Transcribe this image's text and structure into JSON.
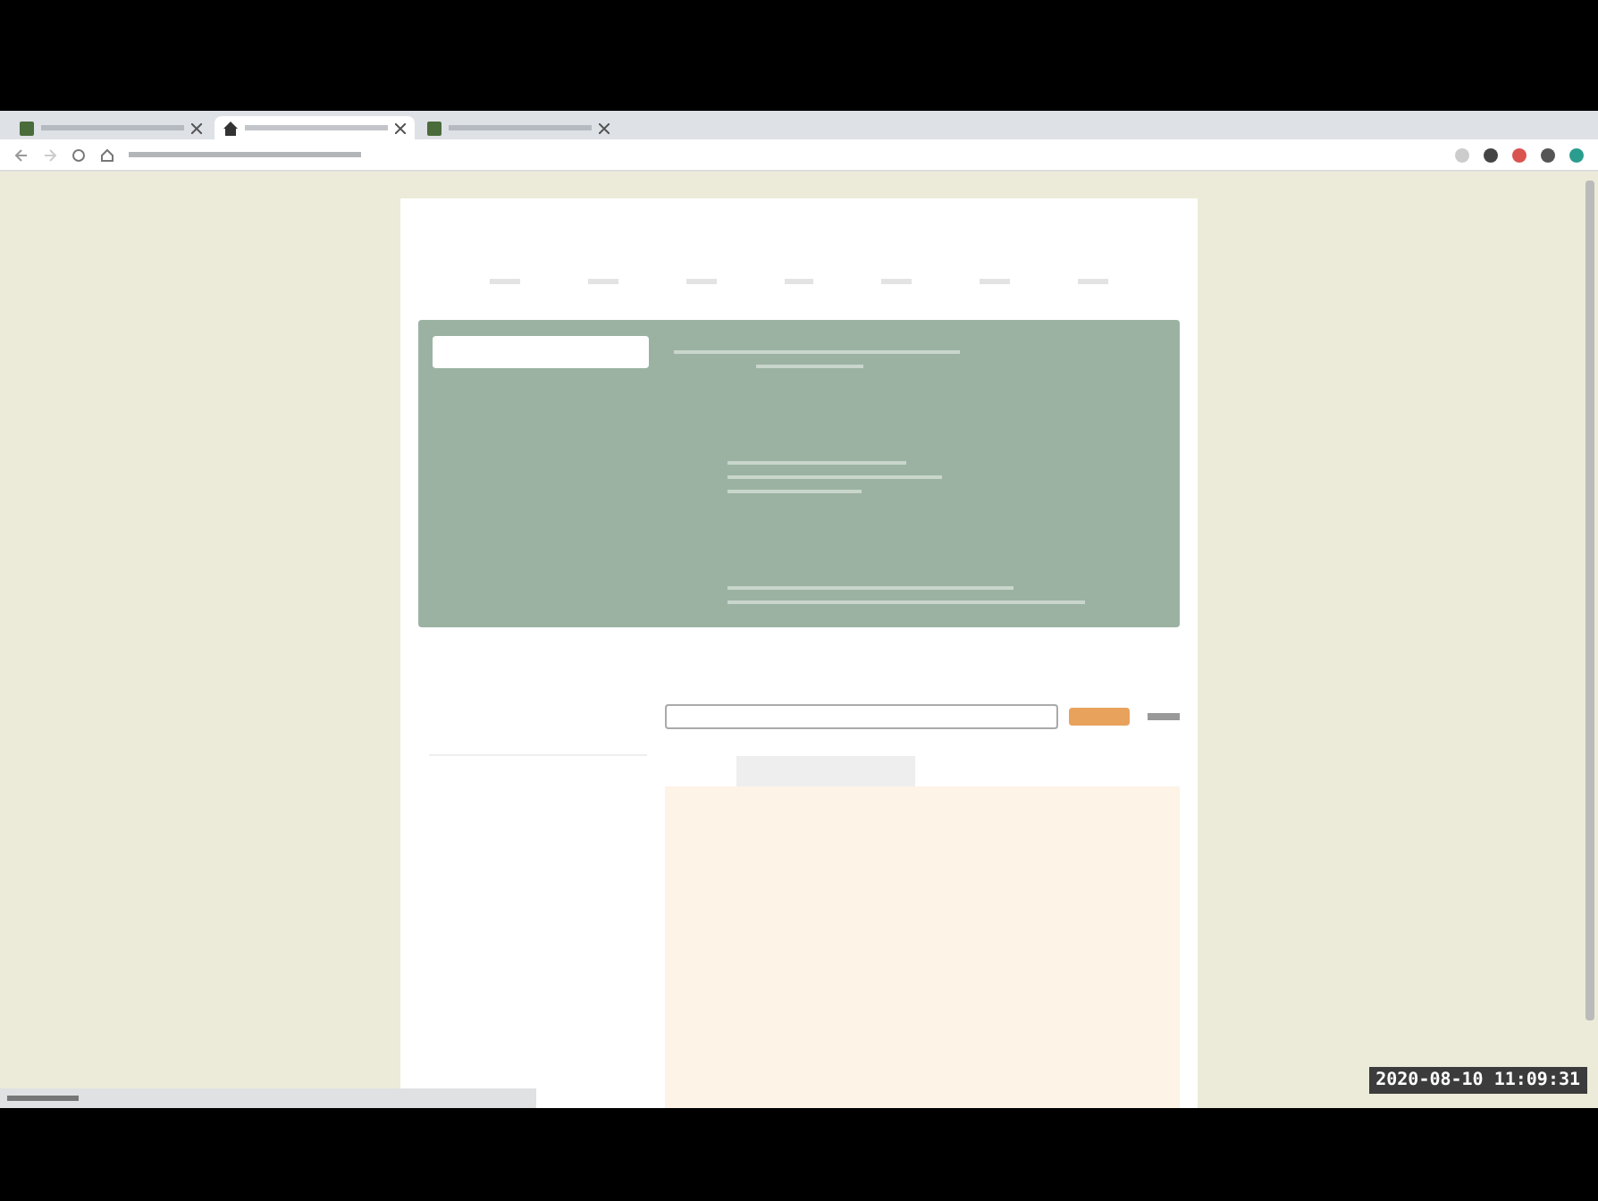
{
  "browser": {
    "tabs": [
      {
        "kind": "page",
        "selected": false
      },
      {
        "kind": "home",
        "selected": true
      },
      {
        "kind": "page",
        "selected": false
      }
    ]
  },
  "video": {
    "timestamp": "2020-08-10 11:09:31"
  }
}
